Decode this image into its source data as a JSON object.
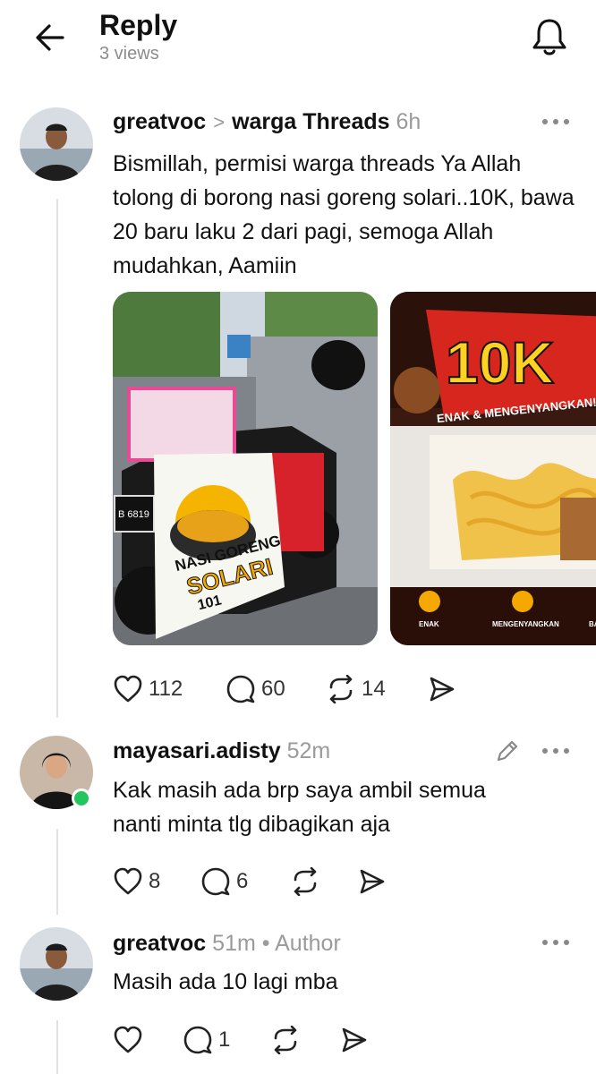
{
  "header": {
    "title": "Reply",
    "views": "3 views",
    "back_icon": "arrow-left-icon",
    "bell_icon": "bell-icon"
  },
  "posts": [
    {
      "username": "greatvoc",
      "chevron": ">",
      "community": "warga Threads",
      "time": "6h",
      "text": "Bismillah, permisi warga threads Ya Allah tolong di borong nasi goreng solari..10K, bawa 20 baru laku 2 dari pagi, semoga Allah mudahkan, Aamiin",
      "media": {
        "bag_label_top": "NASI GORENG",
        "bag_label_bottom": "SOLARI",
        "bag_number": "101",
        "plate": "B 6819",
        "promo_price": "10K",
        "promo_tagline": "ENAK & MENGENYANGKAN!",
        "promo_features": [
          "ENAK",
          "MENGENYANGKAN",
          "BAHAN PILIHAN"
        ]
      },
      "likes": "112",
      "comments": "60",
      "reposts": "14"
    },
    {
      "username": "mayasari.adisty",
      "time": "52m",
      "text": "Kak masih ada brp saya ambil semua nanti minta tlg dibagikan aja",
      "likes": "8",
      "comments": "6",
      "status": "online"
    },
    {
      "username": "greatvoc",
      "time": "51m",
      "separator": "•",
      "role": "Author",
      "text": "Masih ada 10 lagi mba",
      "comments": "1"
    }
  ],
  "colors": {
    "text": "#111111",
    "muted": "#9a9a9a",
    "online": "#22c55e",
    "promo_red": "#d7261e",
    "promo_yellow": "#ffd21f"
  }
}
